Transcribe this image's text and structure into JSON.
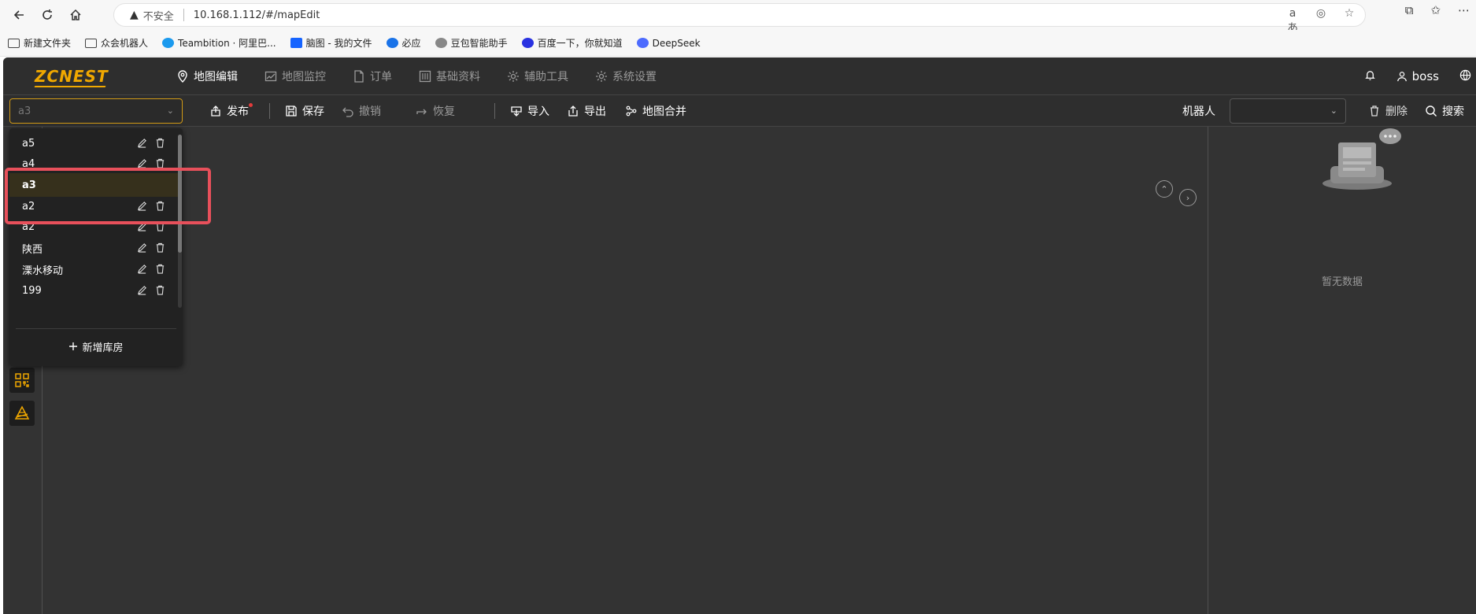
{
  "browser": {
    "insecure_label": "不安全",
    "url": "10.168.1.112/#/mapEdit",
    "bookmarks": [
      {
        "label": "新建文件夹",
        "icon": "folder-icon"
      },
      {
        "label": "众会机器人",
        "icon": "folder-icon"
      },
      {
        "label": "Teambition · 阿里巴...",
        "icon": "teambition-icon",
        "color": "#1b9aee"
      },
      {
        "label": "脑图 - 我的文件",
        "icon": "on-icon",
        "color": "#1664ff"
      },
      {
        "label": "必应",
        "icon": "bing-search-icon",
        "color": "#1a73e8"
      },
      {
        "label": "豆包智能助手",
        "icon": "doubao-icon"
      },
      {
        "label": "百度一下，你就知道",
        "icon": "baidu-paw-icon",
        "color": "#2932e1"
      },
      {
        "label": "DeepSeek",
        "icon": "deepseek-icon",
        "color": "#4d6bfe"
      }
    ]
  },
  "app": {
    "logo": "ZCNEST",
    "menu": [
      {
        "label": "地图编辑",
        "icon": "map-pin-icon",
        "active": true
      },
      {
        "label": "地图监控",
        "icon": "chart-icon",
        "active": false
      },
      {
        "label": "订单",
        "icon": "document-icon",
        "active": false
      },
      {
        "label": "基础资料",
        "icon": "sliders-icon",
        "active": false
      },
      {
        "label": "辅助工具",
        "icon": "gear-icon",
        "active": false
      },
      {
        "label": "系统设置",
        "icon": "gear-icon",
        "active": false
      }
    ],
    "user": "boss"
  },
  "toolbar": {
    "warehouse_value": "a3",
    "publish": "发布",
    "save": "保存",
    "undo": "撤销",
    "redo": "恢复",
    "import": "导入",
    "export": "导出",
    "merge": "地图合并",
    "robot_label": "机器人",
    "delete": "删除",
    "search": "搜索"
  },
  "dropdown": {
    "items": [
      {
        "label": "a5",
        "active": false
      },
      {
        "label": "a4",
        "active": false
      },
      {
        "label": "a3",
        "active": true
      },
      {
        "label": "a2",
        "active": false
      },
      {
        "label": "a2",
        "active": false
      },
      {
        "label": "陕西",
        "active": false
      },
      {
        "label": "溧水移动",
        "active": false
      },
      {
        "label": "199",
        "active": false
      }
    ],
    "add_label": "新增库房"
  },
  "right_panel": {
    "empty_text": "暂无数据"
  },
  "colors": {
    "accent": "#f0a800",
    "highlight_box": "#e8505b",
    "background": "#333333"
  }
}
